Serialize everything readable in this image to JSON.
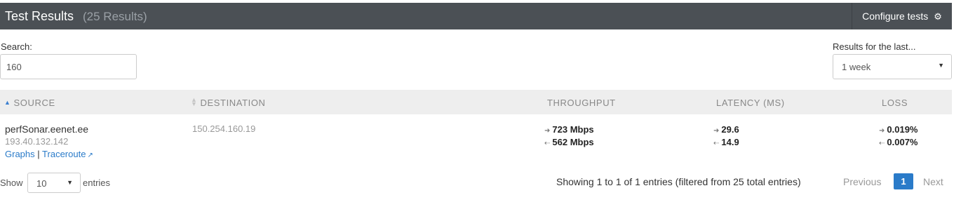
{
  "header": {
    "title": "Test Results",
    "count": "(25 Results)",
    "configure_label": "Configure tests",
    "configure_icon": "gear-icon"
  },
  "search": {
    "label": "Search:",
    "value": "160"
  },
  "range": {
    "label": "Results for the last...",
    "value": "1 week"
  },
  "table": {
    "columns": {
      "source": "SOURCE",
      "destination": "DESTINATION",
      "throughput": "THROUGHPUT",
      "latency": "LATENCY (MS)",
      "loss": "LOSS"
    },
    "rows": [
      {
        "source_name": "perfSonar.eenet.ee",
        "source_ip": "193.40.132.142",
        "graphs_link": "Graphs",
        "separator": "|",
        "traceroute_link": "Traceroute",
        "destination_ip": "150.254.160.19",
        "throughput_out": "723 Mbps",
        "throughput_in": "562 Mbps",
        "latency_out": "29.6",
        "latency_in": "14.9",
        "loss_out": "0.019%",
        "loss_in": "0.007%"
      }
    ]
  },
  "footer": {
    "show_label": "Show",
    "length_value": "10",
    "entries_label": "entries",
    "info": "Showing 1 to 1 of 1 entries (filtered from 25 total entries)",
    "previous": "Previous",
    "current_page": "1",
    "next": "Next"
  },
  "colors": {
    "header_bg": "#4b5055",
    "accent": "#2a7bc9",
    "table_header_bg": "#eeeeee"
  }
}
